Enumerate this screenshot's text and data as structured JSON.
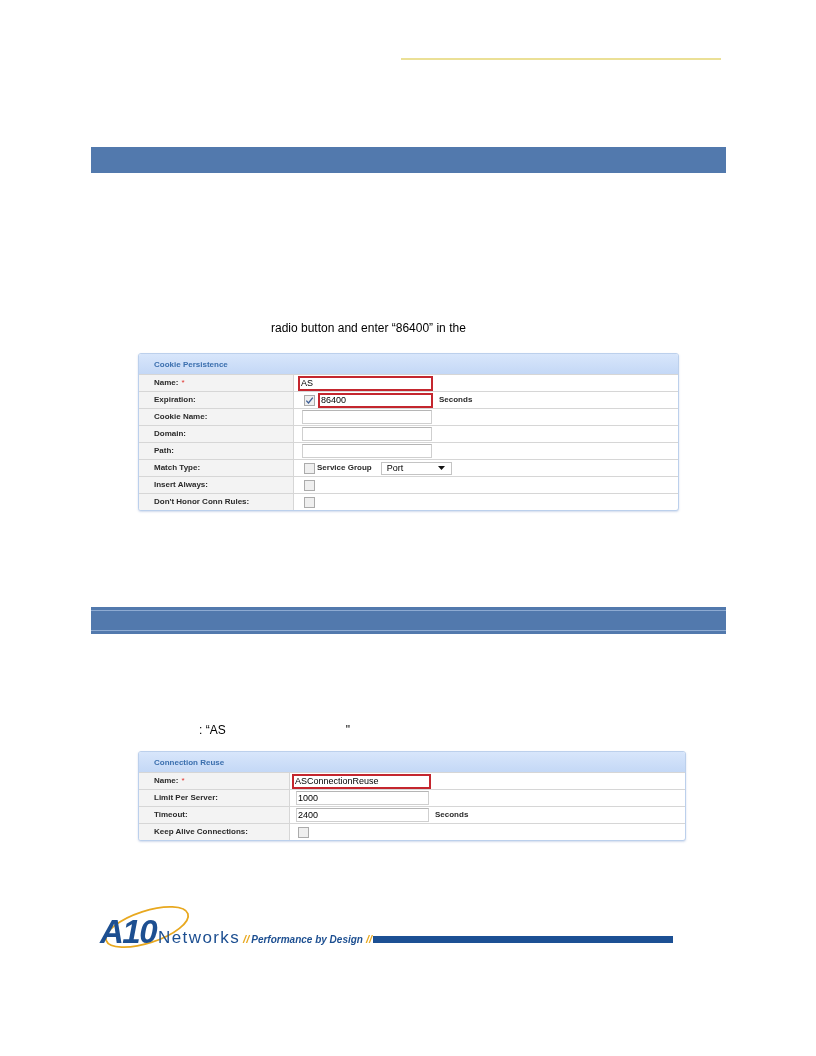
{
  "sections": [
    {
      "instruction_parts": [
        "radio button and enter “86400” in the"
      ],
      "panel": {
        "title": "Cookie Persistence",
        "rows": [
          {
            "label": "Name:",
            "required_mark": "*",
            "controls": [
              {
                "kind": "input",
                "value": "AS",
                "highlighted": true
              }
            ]
          },
          {
            "label": "Expiration:",
            "controls": [
              {
                "kind": "checkbox",
                "checked": true
              },
              {
                "kind": "input",
                "value": "86400",
                "highlighted": true
              },
              {
                "kind": "unit",
                "text": "Seconds"
              }
            ]
          },
          {
            "label": "Cookie Name:",
            "controls": [
              {
                "kind": "input",
                "highlighted": false
              }
            ]
          },
          {
            "label": "Domain:",
            "controls": [
              {
                "kind": "input",
                "highlighted": false
              }
            ]
          },
          {
            "label": "Path:",
            "controls": [
              {
                "kind": "input",
                "highlighted": false
              }
            ]
          },
          {
            "label": "Match Type:",
            "controls": [
              {
                "kind": "checkbox",
                "checked": false,
                "text": "Service Group"
              },
              {
                "kind": "select",
                "value": "Port"
              }
            ]
          },
          {
            "label": "Insert Always:",
            "controls": [
              {
                "kind": "checkbox",
                "checked": false
              }
            ]
          },
          {
            "label": "Don't Honor Conn Rules:",
            "controls": [
              {
                "kind": "checkbox",
                "checked": false
              }
            ]
          }
        ]
      }
    },
    {
      "instruction_parts": [
        ": “AS",
        "\""
      ],
      "panel": {
        "title": "Connection Reuse",
        "rows": [
          {
            "label": "Name:",
            "required_mark": "*",
            "controls": [
              {
                "kind": "input",
                "value": "ASConnectionReuse",
                "highlighted": true
              }
            ]
          },
          {
            "label": "Limit Per Server:",
            "controls": [
              {
                "kind": "input",
                "value": "1000",
                "highlighted": false
              }
            ]
          },
          {
            "label": "Timeout:",
            "controls": [
              {
                "kind": "input",
                "value": "2400",
                "highlighted": false
              },
              {
                "kind": "unit",
                "text": "Seconds"
              }
            ]
          },
          {
            "label": "Keep Alive Connections:",
            "controls": [
              {
                "kind": "checkbox",
                "checked": false
              }
            ]
          }
        ]
      }
    }
  ],
  "footer": {
    "logo_mark": "A10",
    "logo_word": "Networks",
    "separator_left": "//",
    "tagline": "Performance by Design",
    "separator_right": "//"
  }
}
